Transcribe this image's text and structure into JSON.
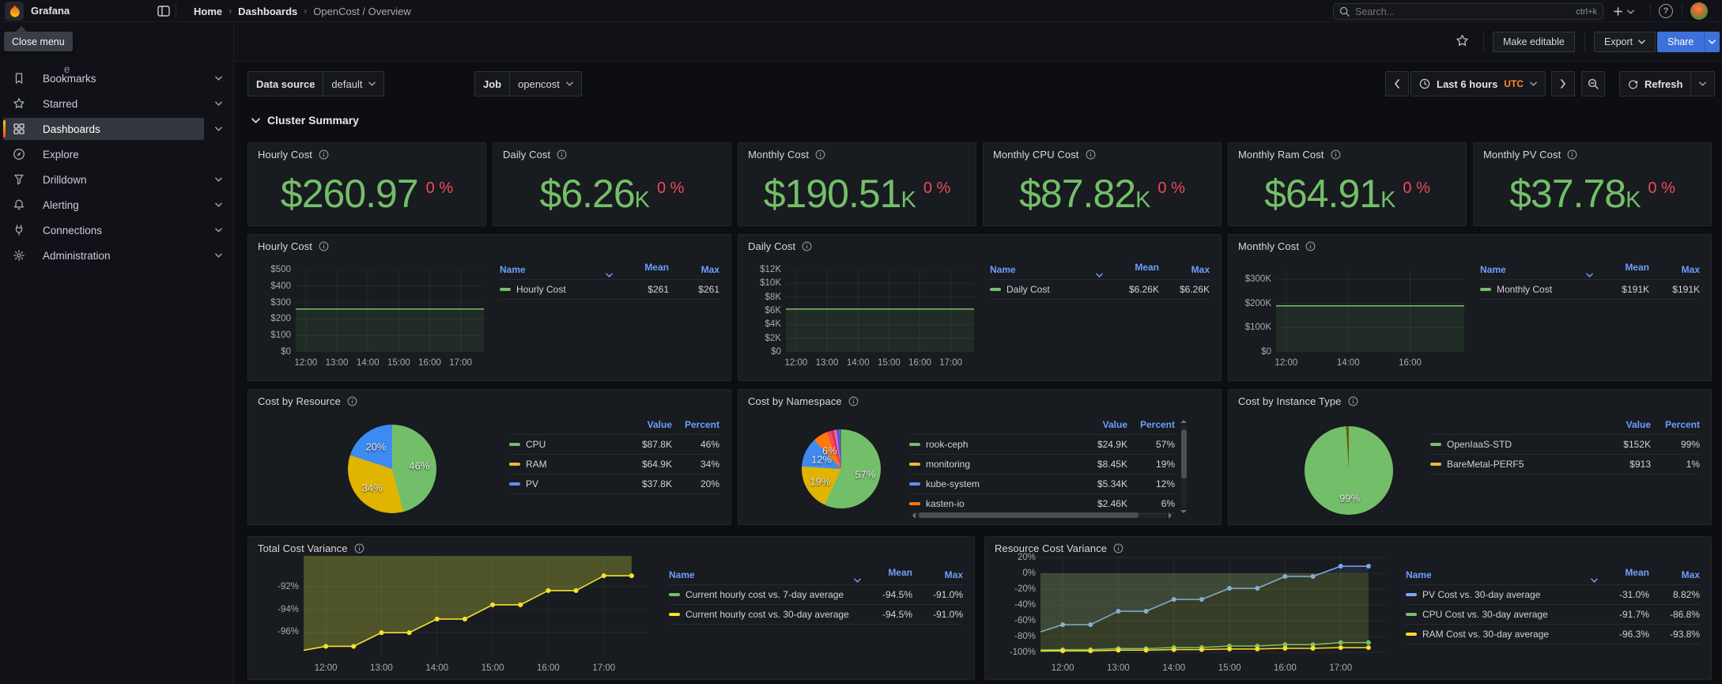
{
  "chrome": {
    "brand": "Grafana",
    "breadcrumb": [
      "Home",
      "Dashboards",
      "OpenCost / Overview"
    ],
    "search": {
      "placeholder": "Search...",
      "shortcut": "ctrl+k"
    },
    "tooltip": "Close menu",
    "partial_nav_text": "e",
    "actions": {
      "make_editable": "Make editable",
      "export": "Export",
      "share": "Share"
    }
  },
  "sidebar": {
    "items": [
      {
        "label": "Bookmarks",
        "icon": "bookmark",
        "chevron": true
      },
      {
        "label": "Starred",
        "icon": "star",
        "chevron": true
      },
      {
        "label": "Dashboards",
        "icon": "grid",
        "chevron": true,
        "active": true
      },
      {
        "label": "Explore",
        "icon": "compass",
        "chevron": false
      },
      {
        "label": "Drilldown",
        "icon": "funnel",
        "chevron": true
      },
      {
        "label": "Alerting",
        "icon": "bell",
        "chevron": true
      },
      {
        "label": "Connections",
        "icon": "plug",
        "chevron": true
      },
      {
        "label": "Administration",
        "icon": "gear",
        "chevron": true
      }
    ]
  },
  "toolbar": {
    "datasource_label": "Data source",
    "datasource_value": "default",
    "job_label": "Job",
    "job_value": "opencost",
    "time_range": "Last 6 hours",
    "timezone": "UTC",
    "refresh_label": "Refresh"
  },
  "section": {
    "title": "Cluster Summary"
  },
  "stats": [
    {
      "title": "Hourly Cost",
      "value": "$260.97",
      "suffix": "",
      "delta": "0 %"
    },
    {
      "title": "Daily Cost",
      "value": "$6.26",
      "suffix": "K",
      "delta": "0 %"
    },
    {
      "title": "Monthly Cost",
      "value": "$190.51",
      "suffix": "K",
      "delta": "0 %"
    },
    {
      "title": "Monthly CPU Cost",
      "value": "$87.82",
      "suffix": "K",
      "delta": "0 %"
    },
    {
      "title": "Monthly Ram Cost",
      "value": "$64.91",
      "suffix": "K",
      "delta": "0 %"
    },
    {
      "title": "Monthly PV Cost",
      "value": "$37.78",
      "suffix": "K",
      "delta": "0 %"
    }
  ],
  "colors": {
    "green": "#73BF69",
    "yellow": "#FADE2A",
    "gold": "#EAB839",
    "blue": "#5794F2",
    "orange": "#FF780A",
    "red": "#F2495C",
    "link_blue": "#6E9FFF",
    "primary": "#3D71D9",
    "utc_orange": "#FF8833"
  },
  "chart_data": [
    {
      "id": "hourly-cost-ts",
      "type": "line",
      "title": "Hourly Cost",
      "ylim": [
        0,
        500
      ],
      "y_ticks": [
        {
          "v": 0,
          "label": "$0"
        },
        {
          "v": 100,
          "label": "$100"
        },
        {
          "v": 200,
          "label": "$200"
        },
        {
          "v": 300,
          "label": "$300"
        },
        {
          "v": 400,
          "label": "$400"
        },
        {
          "v": 500,
          "label": "$500"
        }
      ],
      "x_domain": [
        11.67,
        17.75
      ],
      "x_ticks": [
        {
          "h": 12,
          "label": "12:00"
        },
        {
          "h": 13,
          "label": "13:00"
        },
        {
          "h": 14,
          "label": "14:00"
        },
        {
          "h": 15,
          "label": "15:00"
        },
        {
          "h": 16,
          "label": "16:00"
        },
        {
          "h": 17,
          "label": "17:00"
        }
      ],
      "series": [
        {
          "name": "Hourly Cost",
          "color": "#73BF69",
          "flat_value": 261
        }
      ],
      "legend": {
        "columns": [
          "Name",
          "Mean",
          "Max"
        ],
        "rows": [
          {
            "name": "Hourly Cost",
            "color": "#73BF69",
            "mean": "$261",
            "max": "$261"
          }
        ]
      }
    },
    {
      "id": "daily-cost-ts",
      "type": "line",
      "title": "Daily Cost",
      "ylim": [
        0,
        12000
      ],
      "y_ticks": [
        {
          "v": 0,
          "label": "$0"
        },
        {
          "v": 2000,
          "label": "$2K"
        },
        {
          "v": 4000,
          "label": "$4K"
        },
        {
          "v": 6000,
          "label": "$6K"
        },
        {
          "v": 8000,
          "label": "$8K"
        },
        {
          "v": 10000,
          "label": "$10K"
        },
        {
          "v": 12000,
          "label": "$12K"
        }
      ],
      "x_domain": [
        11.67,
        17.75
      ],
      "x_ticks": [
        {
          "h": 12,
          "label": "12:00"
        },
        {
          "h": 13,
          "label": "13:00"
        },
        {
          "h": 14,
          "label": "14:00"
        },
        {
          "h": 15,
          "label": "15:00"
        },
        {
          "h": 16,
          "label": "16:00"
        },
        {
          "h": 17,
          "label": "17:00"
        }
      ],
      "series": [
        {
          "name": "Daily Cost",
          "color": "#73BF69",
          "flat_value": 6260
        }
      ],
      "legend": {
        "columns": [
          "Name",
          "Mean",
          "Max"
        ],
        "rows": [
          {
            "name": "Daily Cost",
            "color": "#73BF69",
            "mean": "$6.26K",
            "max": "$6.26K"
          }
        ]
      }
    },
    {
      "id": "monthly-cost-ts",
      "type": "line",
      "title": "Monthly Cost",
      "ylim": [
        0,
        340000
      ],
      "y_ticks": [
        {
          "v": 0,
          "label": "$0"
        },
        {
          "v": 100000,
          "label": "$100K"
        },
        {
          "v": 200000,
          "label": "$200K"
        },
        {
          "v": 300000,
          "label": "$300K"
        }
      ],
      "x_domain": [
        11.67,
        17.75
      ],
      "x_ticks": [
        {
          "h": 12,
          "label": "12:00"
        },
        {
          "h": 14,
          "label": "14:00"
        },
        {
          "h": 16,
          "label": "16:00"
        }
      ],
      "series": [
        {
          "name": "Monthly Cost",
          "color": "#73BF69",
          "flat_value": 190510
        }
      ],
      "legend": {
        "columns": [
          "Name",
          "Mean",
          "Max"
        ],
        "rows": [
          {
            "name": "Monthly Cost",
            "color": "#73BF69",
            "mean": "$191K",
            "max": "$191K"
          }
        ]
      }
    },
    {
      "id": "cost-by-resource",
      "type": "pie",
      "title": "Cost by Resource",
      "slices": [
        {
          "label": "CPU",
          "value": "$87.8K",
          "percent": 46,
          "color": "#73BF69",
          "show_label": true,
          "in_legend": true
        },
        {
          "label": "RAM",
          "value": "$64.9K",
          "percent": 34,
          "color": "#E0B400",
          "legend_color": "#EAB839",
          "show_label": true,
          "in_legend": true
        },
        {
          "label": "PV",
          "value": "$37.8K",
          "percent": 20,
          "color": "#3D8BF2",
          "legend_color": "#5794F2",
          "show_label": true,
          "in_legend": true
        }
      ],
      "legend": {
        "columns": [
          "Value",
          "Percent"
        ]
      }
    },
    {
      "id": "cost-by-namespace",
      "type": "pie",
      "title": "Cost by Namespace",
      "scrollbars": true,
      "slices": [
        {
          "label": "rook-ceph",
          "value": "$24.9K",
          "percent": 57,
          "color": "#73BF69",
          "show_label": true,
          "in_legend": true
        },
        {
          "label": "monitoring",
          "value": "$8.45K",
          "percent": 19,
          "color": "#E0B400",
          "legend_color": "#EAB839",
          "show_label": true,
          "in_legend": true
        },
        {
          "label": "kube-system",
          "value": "$5.34K",
          "percent": 12,
          "color": "#3D8BF2",
          "legend_color": "#5794F2",
          "show_label": true,
          "in_legend": true
        },
        {
          "label": "kasten-io",
          "value": "$2.46K",
          "percent": 6,
          "color": "#FF780A",
          "show_label": true,
          "in_legend": true
        },
        {
          "label": "",
          "percent": 1.8,
          "color": "#F2495C",
          "show_label": false,
          "in_legend": false
        },
        {
          "label": "",
          "percent": 1.2,
          "color": "#E02F44",
          "show_label": false,
          "in_legend": false
        },
        {
          "label": "",
          "percent": 1.1,
          "color": "#B877D9",
          "show_label": false,
          "in_legend": false
        },
        {
          "label": "",
          "percent": 0.9,
          "color": "#8F3BB8",
          "show_label": false,
          "in_legend": false
        },
        {
          "label": "",
          "percent": 0.6,
          "color": "#3274D9",
          "show_label": false,
          "in_legend": false
        },
        {
          "label": "",
          "percent": 0.4,
          "color": "#37872D",
          "show_label": false,
          "in_legend": false
        }
      ],
      "legend": {
        "columns": [
          "Value",
          "Percent"
        ]
      }
    },
    {
      "id": "cost-by-instance-type",
      "type": "pie",
      "title": "Cost by Instance Type",
      "slices": [
        {
          "label": "OpenIaaS-STD",
          "value": "$152K",
          "percent": 99,
          "color": "#73BF69",
          "show_label": true,
          "in_legend": true
        },
        {
          "label": "BareMetal-PERF5",
          "value": "$913",
          "percent": 1,
          "color": "#6b5e10",
          "legend_color": "#EAB839",
          "show_label": false,
          "in_legend": true
        }
      ],
      "legend": {
        "columns": [
          "Value",
          "Percent"
        ]
      }
    },
    {
      "id": "total-cost-variance",
      "type": "step-line",
      "title": "Total Cost Variance",
      "ylim": [
        -98.2,
        -89.3
      ],
      "y_ticks": [
        {
          "v": -92,
          "label": "-92%"
        },
        {
          "v": -94,
          "label": "-94%"
        },
        {
          "v": -96,
          "label": "-96%"
        }
      ],
      "x_domain": [
        11.6,
        17.8
      ],
      "x_points": [
        11.6,
        12,
        12.5,
        13,
        13.5,
        14,
        14.5,
        15,
        15.5,
        16,
        16.5,
        17,
        17.5
      ],
      "x_ticks": [
        {
          "h": 12,
          "label": "12:00"
        },
        {
          "h": 13,
          "label": "13:00"
        },
        {
          "h": 14,
          "label": "14:00"
        },
        {
          "h": 15,
          "label": "15:00"
        },
        {
          "h": 16,
          "label": "16:00"
        },
        {
          "h": 17,
          "label": "17:00"
        }
      ],
      "fill_to_zero": true,
      "series": [
        {
          "name": "Current hourly cost vs. 7-day average",
          "color": "#73BF69",
          "fill_alpha": 0.14,
          "values": [
            -97.6,
            -97.25,
            -97.25,
            -96.05,
            -96.05,
            -94.85,
            -94.85,
            -93.6,
            -93.6,
            -92.35,
            -92.35,
            -91.05,
            -91.05
          ]
        },
        {
          "name": "Current hourly cost vs. 30-day average",
          "color": "#FADE2A",
          "fill_alpha": 0.2,
          "values": [
            -97.6,
            -97.25,
            -97.25,
            -96.05,
            -96.05,
            -94.85,
            -94.85,
            -93.6,
            -93.6,
            -92.35,
            -92.35,
            -91.05,
            -91.05
          ]
        }
      ],
      "legend": {
        "columns": [
          "Name",
          "Mean",
          "Max"
        ],
        "rows": [
          {
            "name": "Current hourly cost vs. 7-day average",
            "color": "#73BF69",
            "mean": "-94.5%",
            "max": "-91.0%"
          },
          {
            "name": "Current hourly cost vs. 30-day average",
            "color": "#FADE2A",
            "mean": "-94.5%",
            "max": "-91.0%"
          }
        ]
      }
    },
    {
      "id": "resource-cost-variance",
      "type": "step-line",
      "title": "Resource Cost Variance",
      "ylim": [
        -106,
        22
      ],
      "y_ticks": [
        {
          "v": 20,
          "label": "20%"
        },
        {
          "v": 0,
          "label": "0%"
        },
        {
          "v": -20,
          "label": "-20%"
        },
        {
          "v": -40,
          "label": "-40%"
        },
        {
          "v": -60,
          "label": "-60%"
        },
        {
          "v": -80,
          "label": "-80%"
        },
        {
          "v": -100,
          "label": "-100%"
        }
      ],
      "x_domain": [
        11.6,
        17.8
      ],
      "x_points": [
        11.6,
        12,
        12.5,
        13,
        13.5,
        14,
        14.5,
        15,
        15.5,
        16,
        16.5,
        17,
        17.5
      ],
      "x_ticks": [
        {
          "h": 12,
          "label": "12:00"
        },
        {
          "h": 13,
          "label": "13:00"
        },
        {
          "h": 14,
          "label": "14:00"
        },
        {
          "h": 15,
          "label": "15:00"
        },
        {
          "h": 16,
          "label": "16:00"
        },
        {
          "h": 17,
          "label": "17:00"
        }
      ],
      "fill_to_zero": true,
      "series": [
        {
          "name": "PV Cost vs. 30-day average",
          "color": "#79A9F5",
          "fill_alpha": 0.1,
          "values": [
            -74,
            -65,
            -65,
            -48,
            -48,
            -33,
            -33,
            -19,
            -19,
            -4,
            -4,
            9,
            9
          ]
        },
        {
          "name": "CPU Cost vs. 30-day average",
          "color": "#73BF69",
          "fill_alpha": 0.1,
          "values": [
            -97,
            -96.6,
            -96.6,
            -95.3,
            -95.3,
            -93.9,
            -93.9,
            -92,
            -92,
            -90.2,
            -90.2,
            -87.6,
            -87.6
          ]
        },
        {
          "name": "RAM Cost vs. 30-day average",
          "color": "#FADE2A",
          "fill_alpha": 0.1,
          "values": [
            -98.4,
            -98.1,
            -98.1,
            -97.3,
            -97.3,
            -96.5,
            -96.5,
            -95.7,
            -95.7,
            -94.9,
            -94.9,
            -94,
            -94
          ]
        }
      ],
      "legend": {
        "columns": [
          "Name",
          "Mean",
          "Max"
        ],
        "rows": [
          {
            "name": "PV Cost vs. 30-day average",
            "color": "#79A9F5",
            "mean": "-31.0%",
            "max": "8.82%"
          },
          {
            "name": "CPU Cost vs. 30-day average",
            "color": "#73BF69",
            "mean": "-91.7%",
            "max": "-86.8%"
          },
          {
            "name": "RAM Cost vs. 30-day average",
            "color": "#FADE2A",
            "mean": "-96.3%",
            "max": "-93.8%"
          }
        ]
      }
    }
  ]
}
